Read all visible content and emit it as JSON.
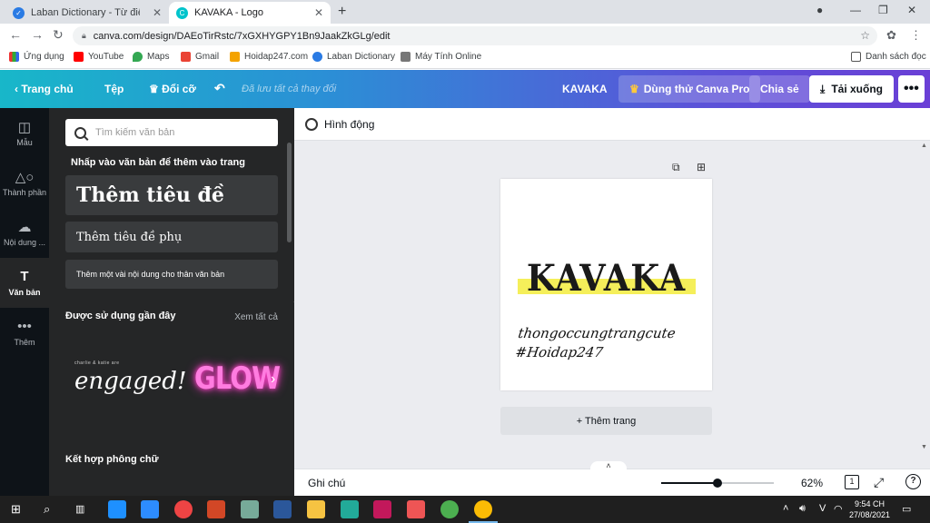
{
  "browser": {
    "tabs": [
      {
        "title": "Laban Dictionary - Từ điển Anh Việt",
        "active": false
      },
      {
        "title": "KAVAKA - Logo",
        "active": true
      }
    ],
    "new_tab": "+",
    "url": "canva.com/design/DAEoTirRstc/7xGXHYGPY1Bn9JaakZkGLg/edit",
    "bookmarks": [
      {
        "label": "Ứng dụng"
      },
      {
        "label": "YouTube"
      },
      {
        "label": "Maps"
      },
      {
        "label": "Gmail"
      },
      {
        "label": "Hoidap247.com"
      },
      {
        "label": "Laban Dictionary"
      },
      {
        "label": "Máy Tính Online"
      }
    ],
    "reading_list": "Danh sách đọc"
  },
  "header": {
    "home": "Trang chủ",
    "file": "Tệp",
    "resize": "Đổi cỡ",
    "saved": "Đã lưu tất cả thay đổi",
    "doc_title": "KAVAKA",
    "try_pro": "Dùng thử Canva Pro",
    "share": "Chia sẻ",
    "download": "Tải xuống"
  },
  "rail": [
    {
      "label": "Mẫu",
      "icon": "template-icon"
    },
    {
      "label": "Thành phần",
      "icon": "elements-icon"
    },
    {
      "label": "Nội dung ...",
      "icon": "upload-icon"
    },
    {
      "label": "Văn bản",
      "icon": "text-icon"
    },
    {
      "label": "Thêm",
      "icon": "more-icon"
    }
  ],
  "panel": {
    "search_placeholder": "Tìm kiếm văn bản",
    "hint": "Nhấp vào văn bản để thêm vào trang",
    "add_title": "Thêm tiêu đề",
    "add_subtitle": "Thêm tiêu đề phụ",
    "add_body": "Thêm một vài nội dung cho thân văn bản",
    "recent": "Được sử dụng gần đây",
    "see_all": "Xem tất cả",
    "sample1_small": "charlie & katie are",
    "sample1_big": "engaged!",
    "sample2": "GLOW",
    "font_pairing": "Kết hợp phông chữ"
  },
  "editor": {
    "animate": "Hình động",
    "logo_text": "KAVAKA",
    "script_line1": "thongoccungtrangcute",
    "script_line2": "#Hoidap247",
    "add_page": "+ Thêm trang",
    "notes": "Ghi chú",
    "zoom": "62%",
    "zoom_fraction": 0.5,
    "page_count": "1",
    "help": "?"
  },
  "taskbar": {
    "time": "9:54 CH",
    "date": "27/08/2021",
    "lang": "V"
  },
  "colors": {
    "header_start": "#18b7c9",
    "header_end": "#6a3fd6",
    "highlight": "#f5ef5a",
    "glow": "#ff7ce0"
  }
}
